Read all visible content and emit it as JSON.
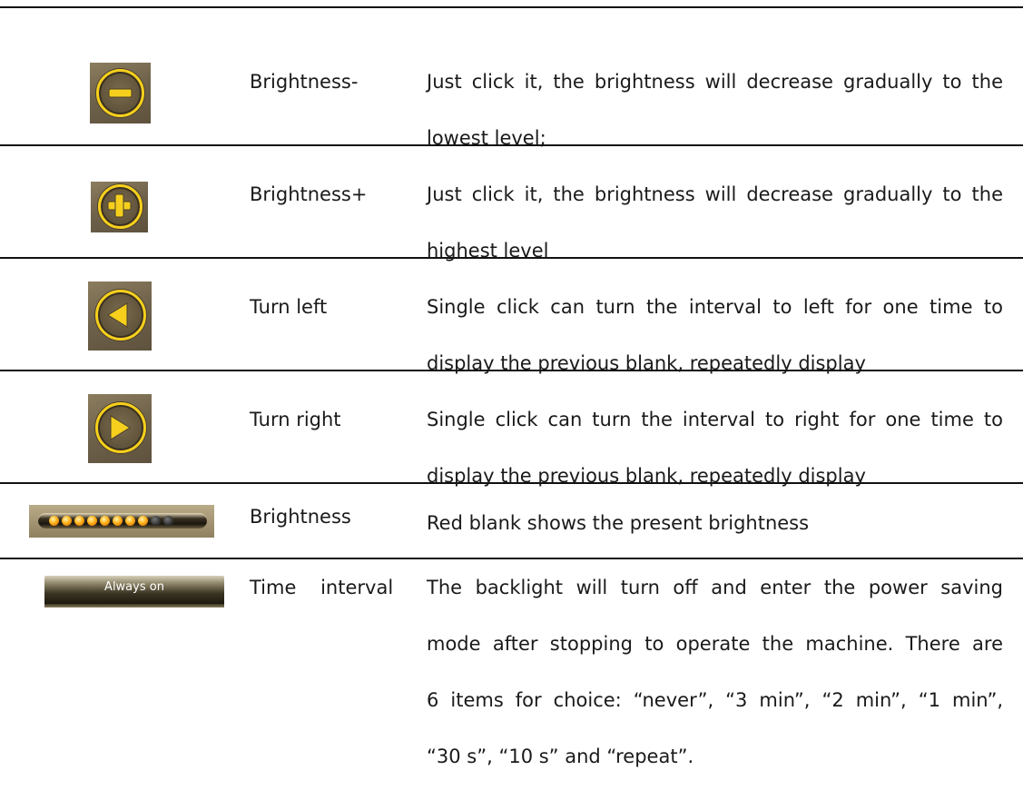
{
  "rows": [
    {
      "icon": "minus-circle-icon",
      "name": "Brightness-",
      "desc_lines": [
        "Just click it, the brightness will decrease gradually to the",
        "lowest level;"
      ]
    },
    {
      "icon": "plus-circle-icon",
      "name": "Brightness+",
      "desc_lines": [
        "Just click it, the brightness will decrease gradually to the",
        "highest level"
      ]
    },
    {
      "icon": "turn-left-icon",
      "name": "Turn left",
      "desc_lines": [
        "Single click can turn the interval to left for one time to",
        "display the previous blank, repeatedly display"
      ]
    },
    {
      "icon": "turn-right-icon",
      "name": "Turn right",
      "desc_lines": [
        "Single click can turn the interval to right for one time to",
        "display the previous blank, repeatedly display"
      ]
    },
    {
      "icon": "brightness-level-bar",
      "name": "Brightness",
      "desc_lines": [
        "Red blank shows the present brightness"
      ],
      "level": {
        "lit": 8,
        "total": 10
      }
    },
    {
      "icon": "time-interval-bar",
      "icon_label": "Always on",
      "name": "Time    interval",
      "desc_lines": [
        "The backlight will turn off and enter the power saving",
        "mode after stopping to operate the machine. There are",
        "6 items for choice: “never”, “3 min”, “2 min”, “1 min”,",
        "“30 s”, “10 s” and “repeat”."
      ]
    }
  ],
  "colors": {
    "icon_gold": "#f5cf1c",
    "icon_bg": "#75684f",
    "rule": "#111111"
  }
}
